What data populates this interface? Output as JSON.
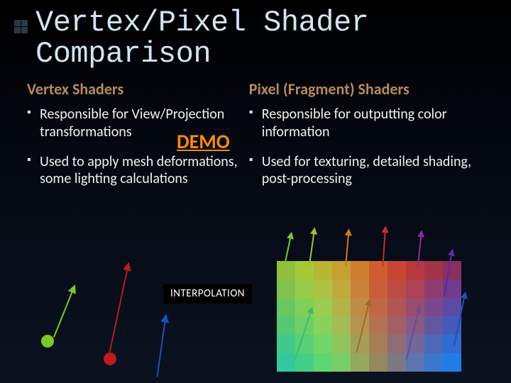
{
  "title": "Vertex/Pixel Shader Comparison",
  "left": {
    "heading": "Vertex Shaders",
    "bullets": [
      "Responsible for View/Projection transformations",
      "Used to apply mesh deformations, some lighting calculations"
    ]
  },
  "right": {
    "heading": "Pixel  (Fragment) Shaders",
    "bullets": [
      "Responsible for outputting color information",
      "Used for texturing, detailed shading, post-processing"
    ]
  },
  "demo_label": "DEMO",
  "interpolation_label": "INTERPOLATION",
  "colors": {
    "title_text": "#cfe6f2",
    "heading_text": "#b78a5a",
    "demo_link": "#ff8a00",
    "vertex_green": "#7cc823",
    "vertex_red": "#c01a1a",
    "vertex_blue": "#1a4fc0"
  }
}
